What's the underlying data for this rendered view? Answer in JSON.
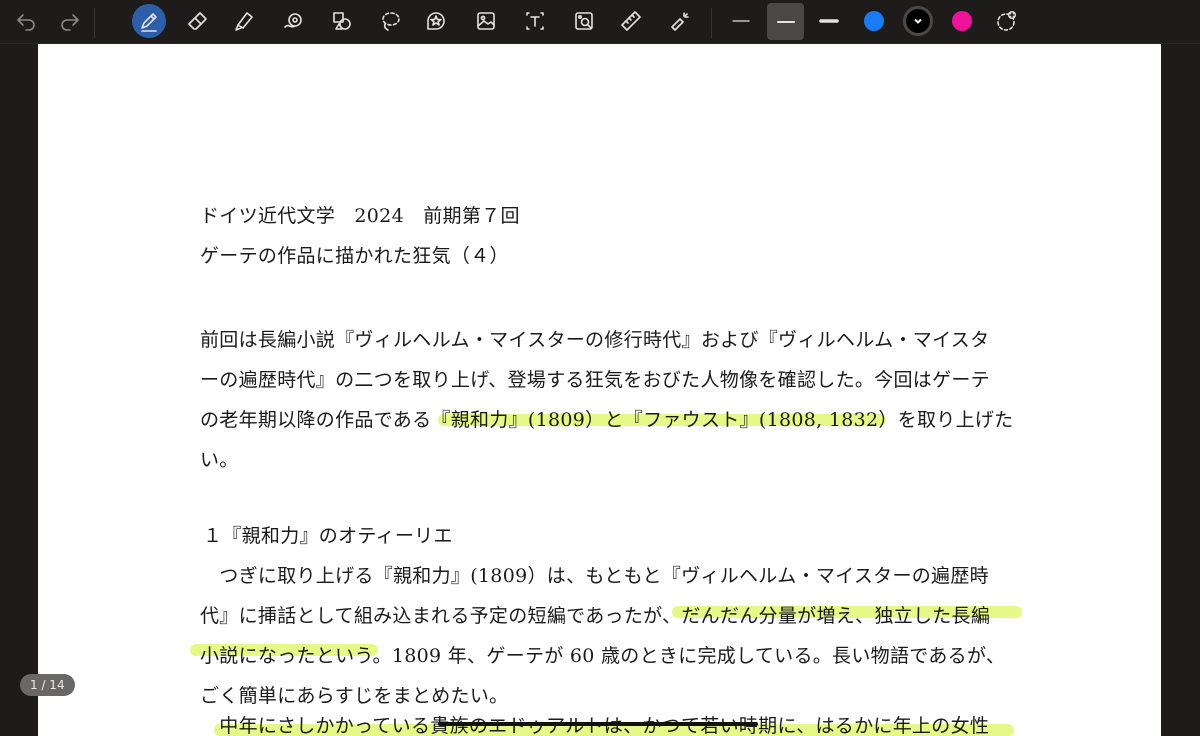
{
  "toolbar": {
    "tools": [
      {
        "name": "undo-icon"
      },
      {
        "name": "redo-icon"
      },
      {
        "name": "pen-icon",
        "active": true
      },
      {
        "name": "eraser-icon"
      },
      {
        "name": "highlighter-icon"
      },
      {
        "name": "shape-recognition-icon"
      },
      {
        "name": "shapes-icon"
      },
      {
        "name": "lasso-icon"
      },
      {
        "name": "sticker-icon"
      },
      {
        "name": "image-icon"
      },
      {
        "name": "text-box-icon"
      },
      {
        "name": "image-search-icon"
      },
      {
        "name": "ruler-icon"
      },
      {
        "name": "laser-pointer-icon"
      }
    ],
    "stroke_widths": [
      "thin",
      "medium",
      "thick"
    ],
    "selected_stroke": "medium",
    "colors": [
      "#1a7cf5",
      "#000000",
      "#f0139a"
    ],
    "selected_color": "#000000"
  },
  "page_indicator": "1 / 14",
  "document": {
    "line1": "ドイツ近代文学　2024　前期第７回",
    "line2": "ゲーテの作品に描かれた狂気（４）",
    "p1_l1": "前回は長編小説『ヴィルヘルム・マイスターの修行時代』および『ヴィルヘルム・マイスタ",
    "p1_l2": "ーの遍歴時代』の二つを取り上げ、登場する狂気をおびた人物像を確認した。今回はゲーテ",
    "p1_l3": "の老年期以降の作品である『親和力』(1809）と『ファウスト』(1808, 1832）を取り上げた",
    "p1_l4": "い。",
    "section1": "１『親和力』のオティーリエ",
    "p2_l1": "　つぎに取り上げる『親和力』(1809）は、もともと『ヴィルヘルム・マイスターの遍歴時",
    "p2_l2": "代』に挿話として組み込まれる予定の短編であったが、だんだん分量が増え、独立した長編",
    "p2_l3": "小説になったという。1809 年、ゲーテが 60 歳のときに完成している。長い物語であるが、",
    "p2_l4": "ごく簡単にあらすじをまとめたい。",
    "p3_l1": "　中年にさしかかっている貴族のエドゥアルトは、かつて若い時期に、はるかに年上の女性"
  }
}
